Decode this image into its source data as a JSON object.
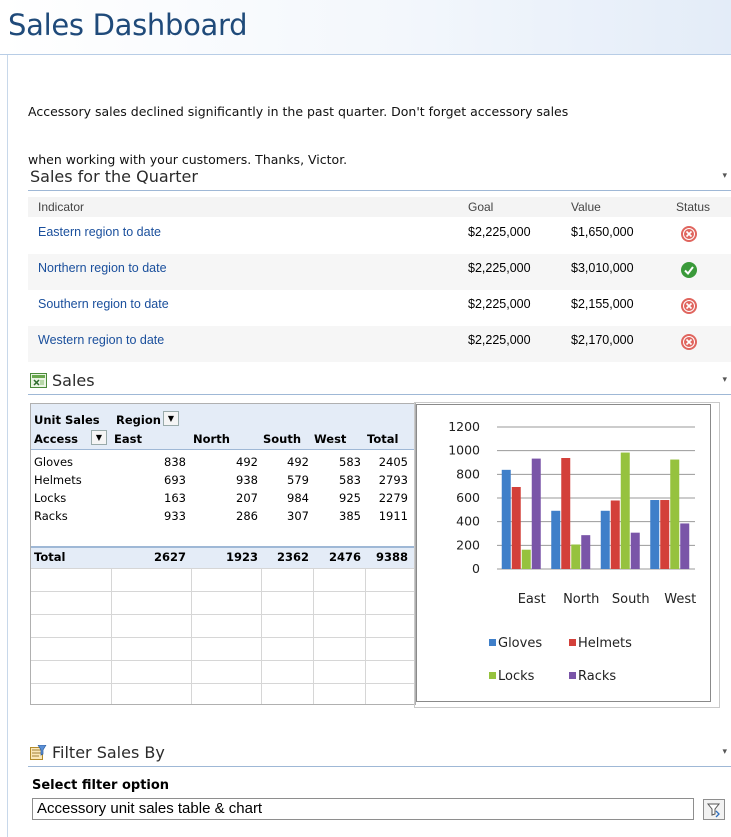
{
  "page": {
    "title": "Sales Dashboard"
  },
  "intro": {
    "line1": "Accessory sales declined significantly in the past quarter. Don't forget accessory sales",
    "line2": "when working with your customers. Thanks, Victor."
  },
  "kpi": {
    "title": "Sales for the Quarter",
    "menu_glyph": "▾",
    "headers": {
      "indicator": "Indicator",
      "goal": "Goal",
      "value": "Value",
      "status": "Status"
    },
    "rows": [
      {
        "indicator": "Eastern region to date",
        "goal": "$2,225,000",
        "value": "$1,650,000",
        "status": "bad"
      },
      {
        "indicator": "Northern region to date",
        "goal": "$2,225,000",
        "value": "$3,010,000",
        "status": "good"
      },
      {
        "indicator": "Southern region to date",
        "goal": "$2,225,000",
        "value": "$2,155,000",
        "status": "bad"
      },
      {
        "indicator": "Western region to date",
        "goal": "$2,225,000",
        "value": "$2,170,000",
        "status": "bad"
      }
    ],
    "colors": {
      "good": "#3a9a3a",
      "bad": "#e0655e"
    }
  },
  "sales": {
    "title": "Sales",
    "menu_glyph": "▾",
    "icon": "excel-icon",
    "pivot": {
      "measure_label": "Unit Sales",
      "column_field": "Region",
      "row_field": "Access",
      "columns": [
        "East",
        "North",
        "South",
        "West",
        "Total"
      ],
      "rows": [
        {
          "label": "Gloves",
          "values": [
            "838",
            "492",
            "492",
            "583",
            "2405"
          ]
        },
        {
          "label": "Helmets",
          "values": [
            "693",
            "938",
            "579",
            "583",
            "2793"
          ]
        },
        {
          "label": "Locks",
          "values": [
            "163",
            "207",
            "984",
            "925",
            "2279"
          ]
        },
        {
          "label": "Racks",
          "values": [
            "933",
            "286",
            "307",
            "385",
            "1911"
          ]
        }
      ],
      "total": {
        "label": "Total",
        "values": [
          "2627",
          "1923",
          "2362",
          "2476",
          "9388"
        ]
      }
    }
  },
  "chart_data": {
    "type": "bar",
    "categories": [
      "East",
      "North",
      "South",
      "West"
    ],
    "series": [
      {
        "name": "Gloves",
        "values": [
          838,
          492,
          492,
          583
        ],
        "color": "#3f7fc9"
      },
      {
        "name": "Helmets",
        "values": [
          693,
          938,
          579,
          583
        ],
        "color": "#d3403a"
      },
      {
        "name": "Locks",
        "values": [
          163,
          207,
          984,
          925
        ],
        "color": "#96c23e"
      },
      {
        "name": "Racks",
        "values": [
          933,
          286,
          307,
          385
        ],
        "color": "#7a55a8"
      }
    ],
    "ylim": [
      0,
      1200
    ],
    "yticks": [
      "0",
      "200",
      "400",
      "600",
      "800",
      "1000",
      "1200"
    ],
    "legend_position": "bottom",
    "grid": true
  },
  "filter": {
    "title": "Filter Sales By",
    "menu_glyph": "▾",
    "icon": "filter-webpart-icon",
    "label": "Select filter option",
    "selected": "Accessory unit sales table & chart",
    "button_icon": "filter-icon"
  },
  "theme": {
    "title_color": "#1f4a7a",
    "link_color": "#1a4f9c",
    "rule_color": "#9fb8d6"
  }
}
